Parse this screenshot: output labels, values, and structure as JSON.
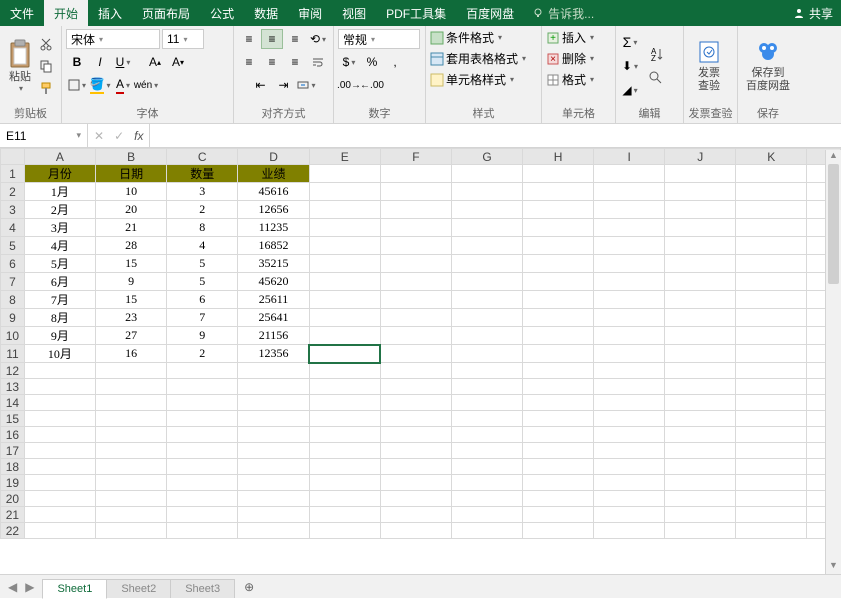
{
  "tabs": {
    "file": "文件",
    "home": "开始",
    "insert": "插入",
    "layout": "页面布局",
    "formulas": "公式",
    "data": "数据",
    "review": "审阅",
    "view": "视图",
    "pdf": "PDF工具集",
    "baidu": "百度网盘",
    "tellme": "告诉我...",
    "share": "共享"
  },
  "ribbon": {
    "clipboard": {
      "paste": "粘贴",
      "label": "剪贴板"
    },
    "font": {
      "name": "宋体",
      "size": "11",
      "label": "字体"
    },
    "align": {
      "label": "对齐方式"
    },
    "number": {
      "format": "常规",
      "label": "数字"
    },
    "styles": {
      "cond": "条件格式",
      "tablefmt": "套用表格格式",
      "cellstyle": "单元格样式",
      "label": "样式"
    },
    "cells": {
      "insert": "插入",
      "delete": "删除",
      "format": "格式",
      "label": "单元格"
    },
    "editing": {
      "label": "编辑"
    },
    "invoice": {
      "btn": "发票\n查验",
      "label": "发票查验"
    },
    "save": {
      "btn": "保存到\n百度网盘",
      "label": "保存"
    }
  },
  "namebox": "E11",
  "columns": [
    "A",
    "B",
    "C",
    "D",
    "E",
    "F",
    "G",
    "H",
    "I",
    "J",
    "K"
  ],
  "row_count": 22,
  "header_row": [
    "月份",
    "日期",
    "数量",
    "业绩"
  ],
  "data_rows": [
    [
      "1月",
      "10",
      "3",
      "45616"
    ],
    [
      "2月",
      "20",
      "2",
      "12656"
    ],
    [
      "3月",
      "21",
      "8",
      "11235"
    ],
    [
      "4月",
      "28",
      "4",
      "16852"
    ],
    [
      "5月",
      "15",
      "5",
      "35215"
    ],
    [
      "6月",
      "9",
      "5",
      "45620"
    ],
    [
      "7月",
      "15",
      "6",
      "25611"
    ],
    [
      "8月",
      "23",
      "7",
      "25641"
    ],
    [
      "9月",
      "27",
      "9",
      "21156"
    ],
    [
      "10月",
      "16",
      "2",
      "12356"
    ]
  ],
  "selected_cell": {
    "row": 11,
    "col": 5
  },
  "sheets": [
    "Sheet1",
    "Sheet2",
    "Sheet3"
  ],
  "active_sheet": 0
}
